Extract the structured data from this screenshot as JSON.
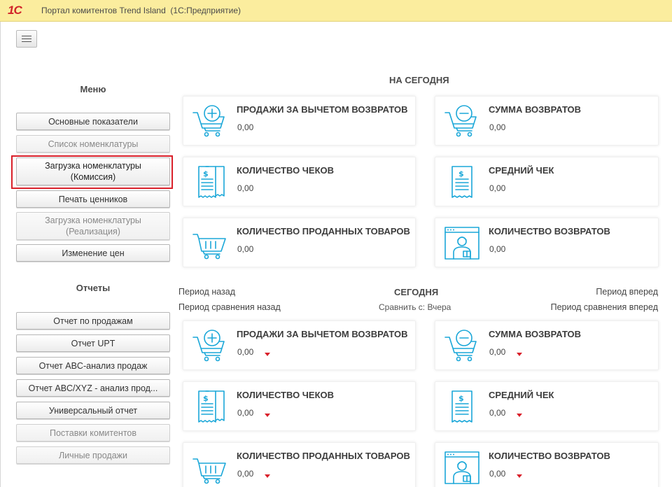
{
  "window": {
    "title": "Портал комитентов Trend Island  (1С:Предприятие)",
    "logo": "1С"
  },
  "sidebar": {
    "menu_heading": "Меню",
    "menu_items": [
      {
        "label": "Основные показатели"
      },
      {
        "label": "Список номенклатуры"
      },
      {
        "label": "Загрузка номенклатуры\n(Комиссия)"
      },
      {
        "label": "Печать ценников"
      },
      {
        "label": "Загрузка номенклатуры\n(Реализация)"
      },
      {
        "label": "Изменение цен"
      }
    ],
    "reports_heading": "Отчеты",
    "report_items": [
      {
        "label": "Отчет по продажам"
      },
      {
        "label": "Отчет UPT"
      },
      {
        "label": "Отчет ABC-анализ продаж"
      },
      {
        "label": "Отчет ABC/XYZ - анализ прод..."
      },
      {
        "label": "Универсальный отчет"
      },
      {
        "label": "Поставки комитентов"
      },
      {
        "label": "Личные продажи"
      }
    ]
  },
  "today": {
    "heading": "НА СЕГОДНЯ",
    "cards": [
      {
        "title": "ПРОДАЖИ ЗА ВЫЧЕТОМ ВОЗВРАТОВ",
        "value": "0,00",
        "icon": "cart-plus-icon"
      },
      {
        "title": "СУММА ВОЗВРАТОВ",
        "value": "0,00",
        "icon": "cart-minus-icon"
      },
      {
        "title": "КОЛИЧЕСТВО ЧЕКОВ",
        "value": "0,00",
        "icon": "receipts-icon"
      },
      {
        "title": "СРЕДНИЙ ЧЕК",
        "value": "0,00",
        "icon": "receipt-icon"
      },
      {
        "title": "КОЛИЧЕСТВО ПРОДАННЫХ ТОВАРОВ",
        "value": "0,00",
        "icon": "cart-icon"
      },
      {
        "title": "КОЛИЧЕСТВО ВОЗВРАТОВ",
        "value": "0,00",
        "icon": "courier-icon"
      }
    ]
  },
  "period": {
    "prev": "Период назад",
    "prev_compare": "Период сравнения назад",
    "current": "СЕГОДНЯ",
    "compare_with": "Сравнить с: Вчера",
    "next": "Период вперед",
    "next_compare": "Период сравнения вперед",
    "cards": [
      {
        "title": "ПРОДАЖИ ЗА ВЫЧЕТОМ ВОЗВРАТОВ",
        "value": "0,00",
        "icon": "cart-plus-icon"
      },
      {
        "title": "СУММА ВОЗВРАТОВ",
        "value": "0,00",
        "icon": "cart-minus-icon"
      },
      {
        "title": "КОЛИЧЕСТВО ЧЕКОВ",
        "value": "0,00",
        "icon": "receipts-icon"
      },
      {
        "title": "СРЕДНИЙ ЧЕК",
        "value": "0,00",
        "icon": "receipt-icon"
      },
      {
        "title": "КОЛИЧЕСТВО ПРОДАННЫХ ТОВАРОВ",
        "value": "0,00",
        "icon": "cart-icon"
      },
      {
        "title": "КОЛИЧЕСТВО ВОЗВРАТОВ",
        "value": "0,00",
        "icon": "courier-icon"
      }
    ]
  },
  "colors": {
    "titlebar": "#fbed9e",
    "accent_icon": "#1aa7d8",
    "trend_down": "#d9202a",
    "highlight": "#d9202a"
  }
}
